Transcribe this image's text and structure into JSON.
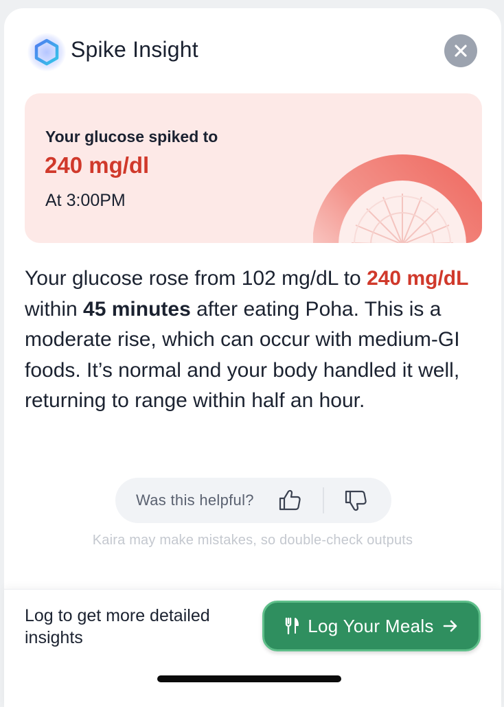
{
  "header": {
    "title": "Spike Insight",
    "logo_icon": "hexagon-glow-icon",
    "close_icon": "close-icon"
  },
  "spike": {
    "label": "Your glucose spiked to",
    "value": "240 mg/dl",
    "time": "At 3:00PM",
    "accent_color": "#d0392b",
    "card_bg": "#fde9e7"
  },
  "insight": {
    "part1": "Your glucose rose from 102 mg/dL to ",
    "value_highlight": "240 mg/dL",
    "part2": " within ",
    "duration_highlight": "45 minutes",
    "part3": " after eating Poha. This is a moderate rise, which can occur with medium-GI foods. It’s normal and your body handled it well, returning to range within half an hour."
  },
  "feedback": {
    "question": "Was this helpful?",
    "up_icon": "thumbs-up-icon",
    "down_icon": "thumbs-down-icon"
  },
  "disclaimer": "Kaira may make mistakes, so double-check outputs",
  "footer": {
    "hint": "Log to get more detailed insights",
    "button_label": "Log Your Meals",
    "button_icon": "fork-knife-icon",
    "arrow_icon": "arrow-right-icon",
    "button_color": "#2f8f5f"
  }
}
